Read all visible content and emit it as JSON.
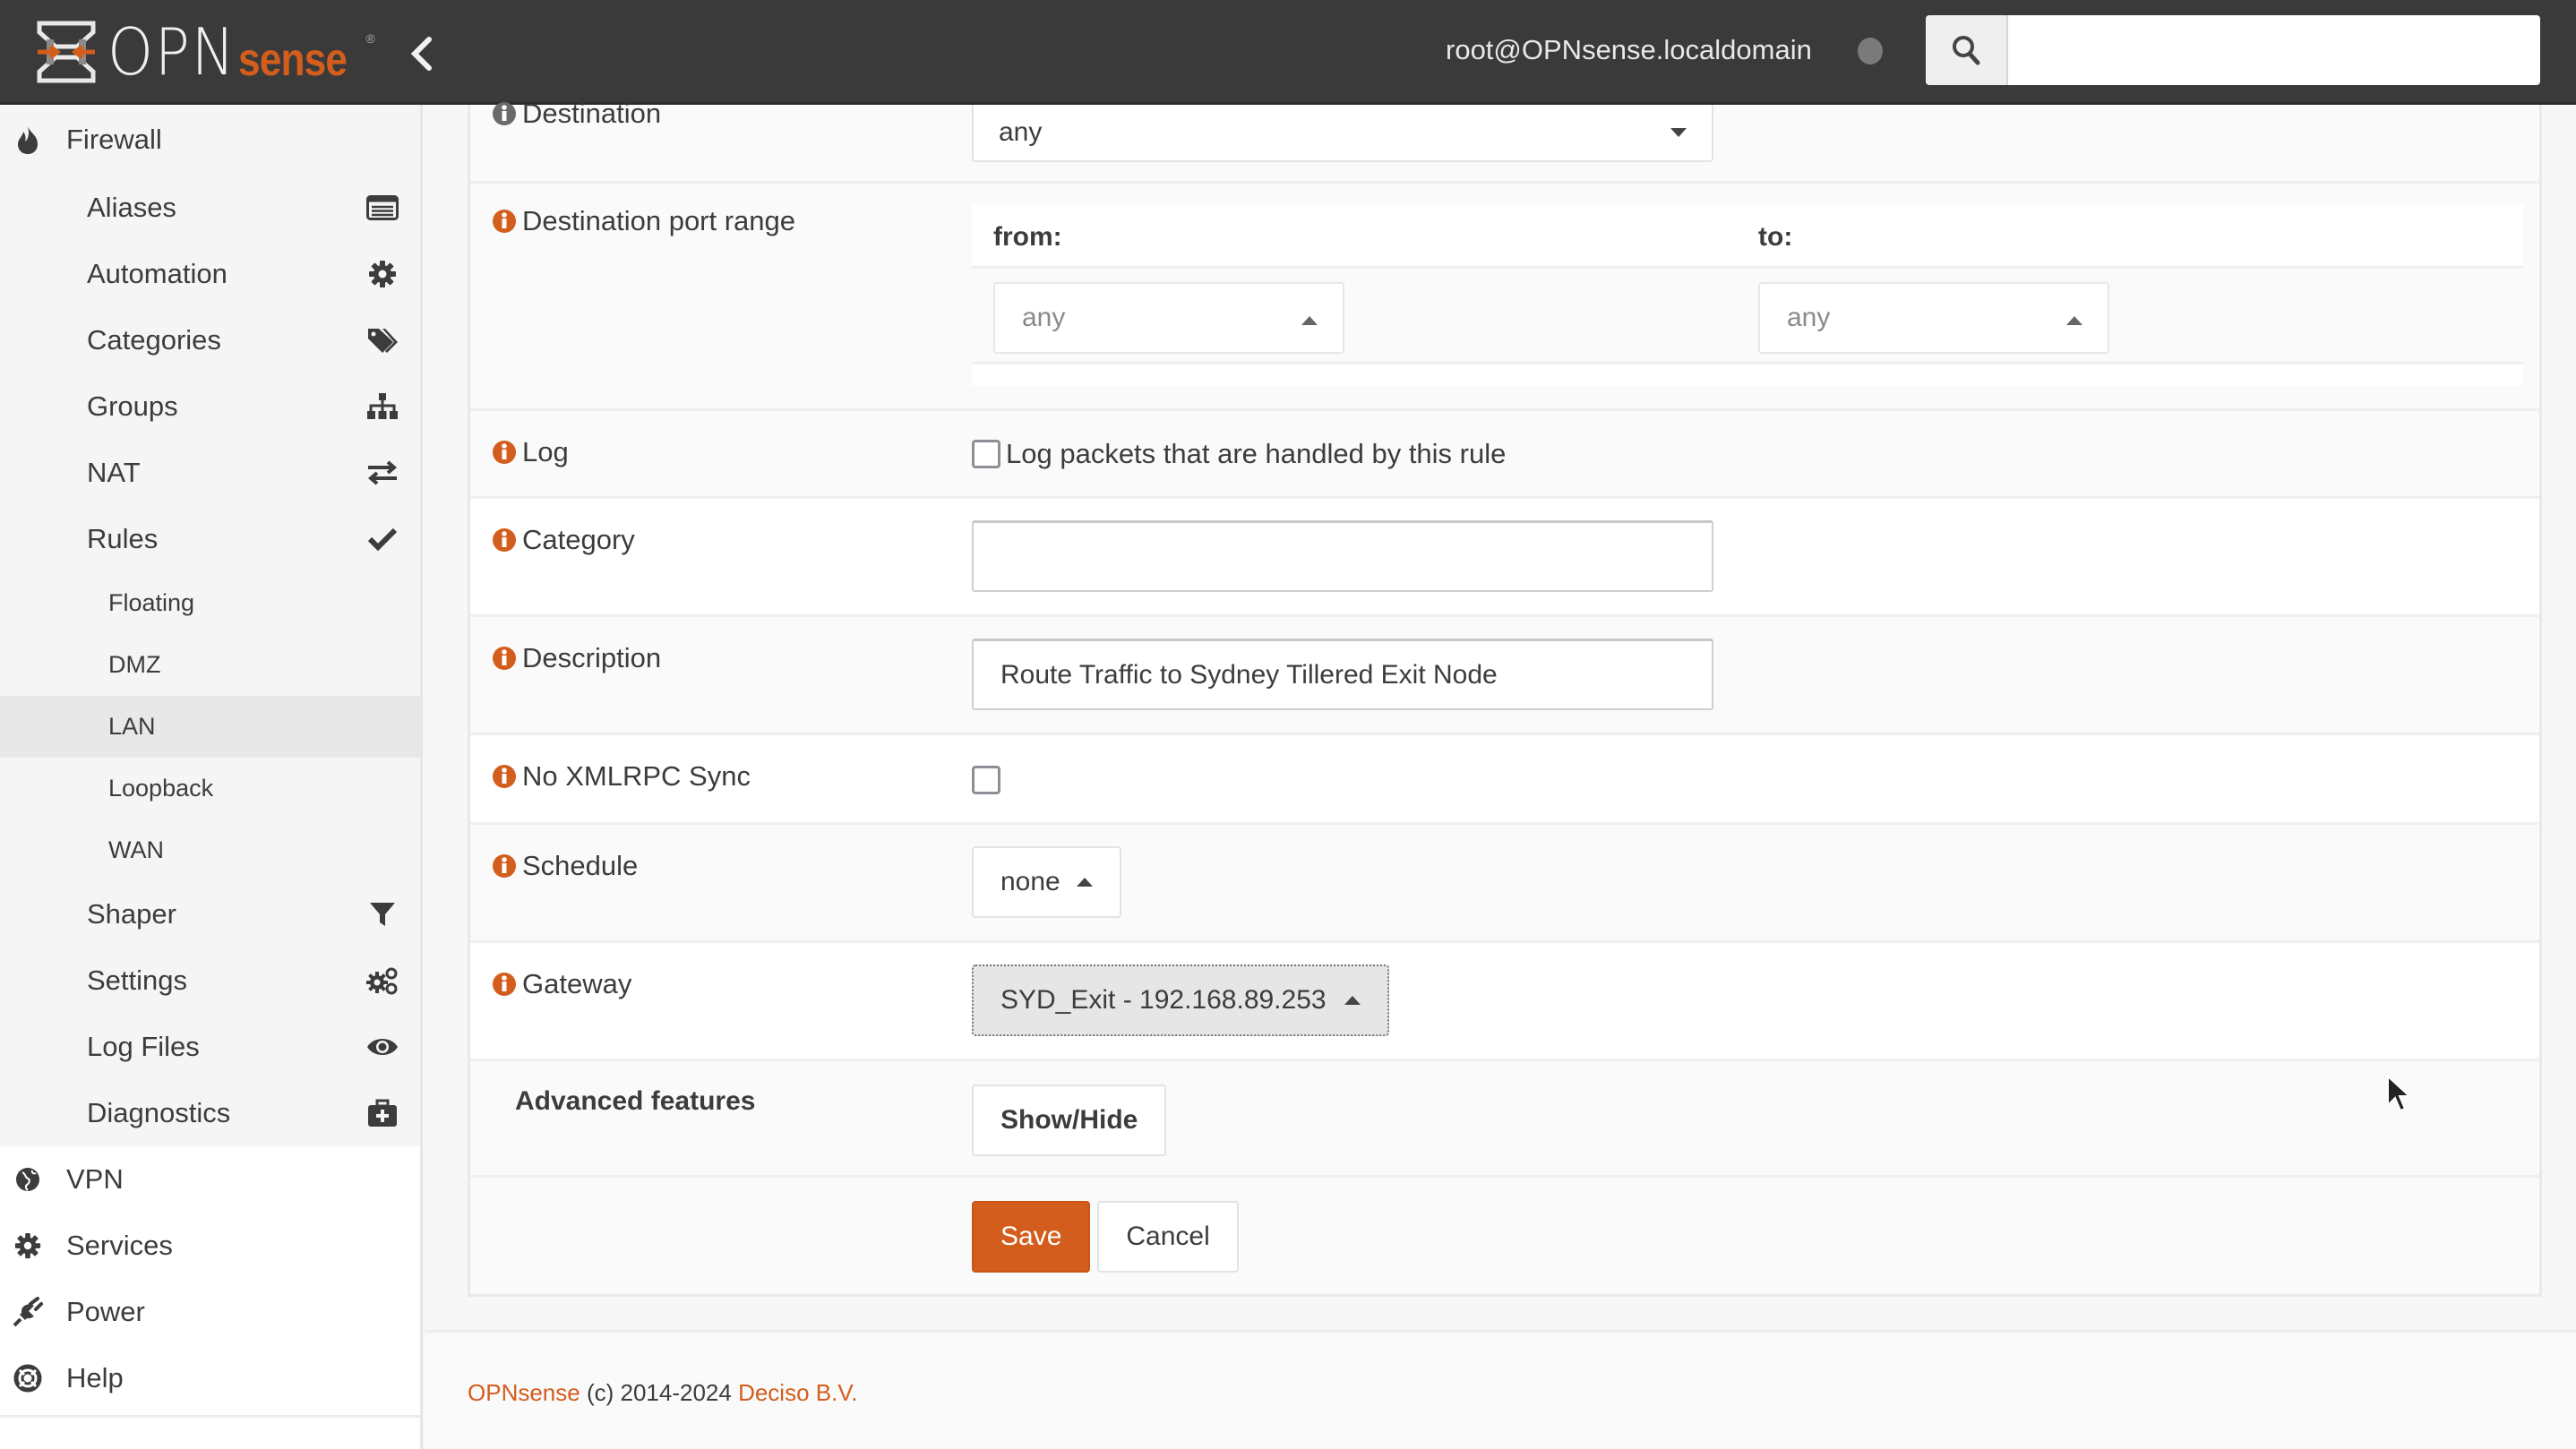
{
  "header": {
    "logo_primary": "OPN",
    "logo_secondary": "sense",
    "logo_reg": "®",
    "user": "root@OPNsense.localdomain",
    "search_placeholder": ""
  },
  "sidebar": {
    "firewall": {
      "label": "Firewall",
      "icon": "fire-icon",
      "items": [
        {
          "label": "Aliases",
          "icon": "list-alt-icon"
        },
        {
          "label": "Automation",
          "icon": "cog-icon"
        },
        {
          "label": "Categories",
          "icon": "tags-icon"
        },
        {
          "label": "Groups",
          "icon": "sitemap-icon"
        },
        {
          "label": "NAT",
          "icon": "exchange-icon"
        },
        {
          "label": "Rules",
          "icon": "check-icon"
        }
      ],
      "rules_children": [
        {
          "label": "Floating",
          "active": false
        },
        {
          "label": "DMZ",
          "active": false
        },
        {
          "label": "LAN",
          "active": true
        },
        {
          "label": "Loopback",
          "active": false
        },
        {
          "label": "WAN",
          "active": false
        }
      ],
      "items_after": [
        {
          "label": "Shaper",
          "icon": "filter-icon"
        },
        {
          "label": "Settings",
          "icon": "cogs-icon"
        },
        {
          "label": "Log Files",
          "icon": "eye-icon"
        },
        {
          "label": "Diagnostics",
          "icon": "medkit-icon"
        }
      ]
    },
    "top_items": [
      {
        "label": "VPN",
        "icon": "globe-icon"
      },
      {
        "label": "Services",
        "icon": "cog-icon"
      },
      {
        "label": "Power",
        "icon": "plug-icon"
      },
      {
        "label": "Help",
        "icon": "life-ring-icon"
      }
    ]
  },
  "form": {
    "destination": {
      "label": "Destination",
      "value": "any"
    },
    "dest_port_range": {
      "label": "Destination port range",
      "from_label": "from:",
      "to_label": "to:",
      "from_value": "any",
      "to_value": "any"
    },
    "log": {
      "label": "Log",
      "checkbox_label": "Log packets that are handled by this rule",
      "checked": false
    },
    "category": {
      "label": "Category",
      "value": ""
    },
    "description": {
      "label": "Description",
      "value": "Route Traffic to Sydney Tillered Exit Node"
    },
    "no_xmlrpc_sync": {
      "label": "No XMLRPC Sync",
      "checked": false
    },
    "schedule": {
      "label": "Schedule",
      "value": "none"
    },
    "gateway": {
      "label": "Gateway",
      "value": "SYD_Exit - 192.168.89.253"
    },
    "advanced": {
      "label": "Advanced features",
      "button": "Show/Hide"
    },
    "save_label": "Save",
    "cancel_label": "Cancel"
  },
  "footer": {
    "brand": "OPNsense",
    "copyright": " (c) 2014-2024 ",
    "company": "Deciso B.V."
  },
  "colors": {
    "accent": "#d35d1c",
    "topbar": "#3a3a3a",
    "sidebar_section": "#f5f5f5"
  }
}
